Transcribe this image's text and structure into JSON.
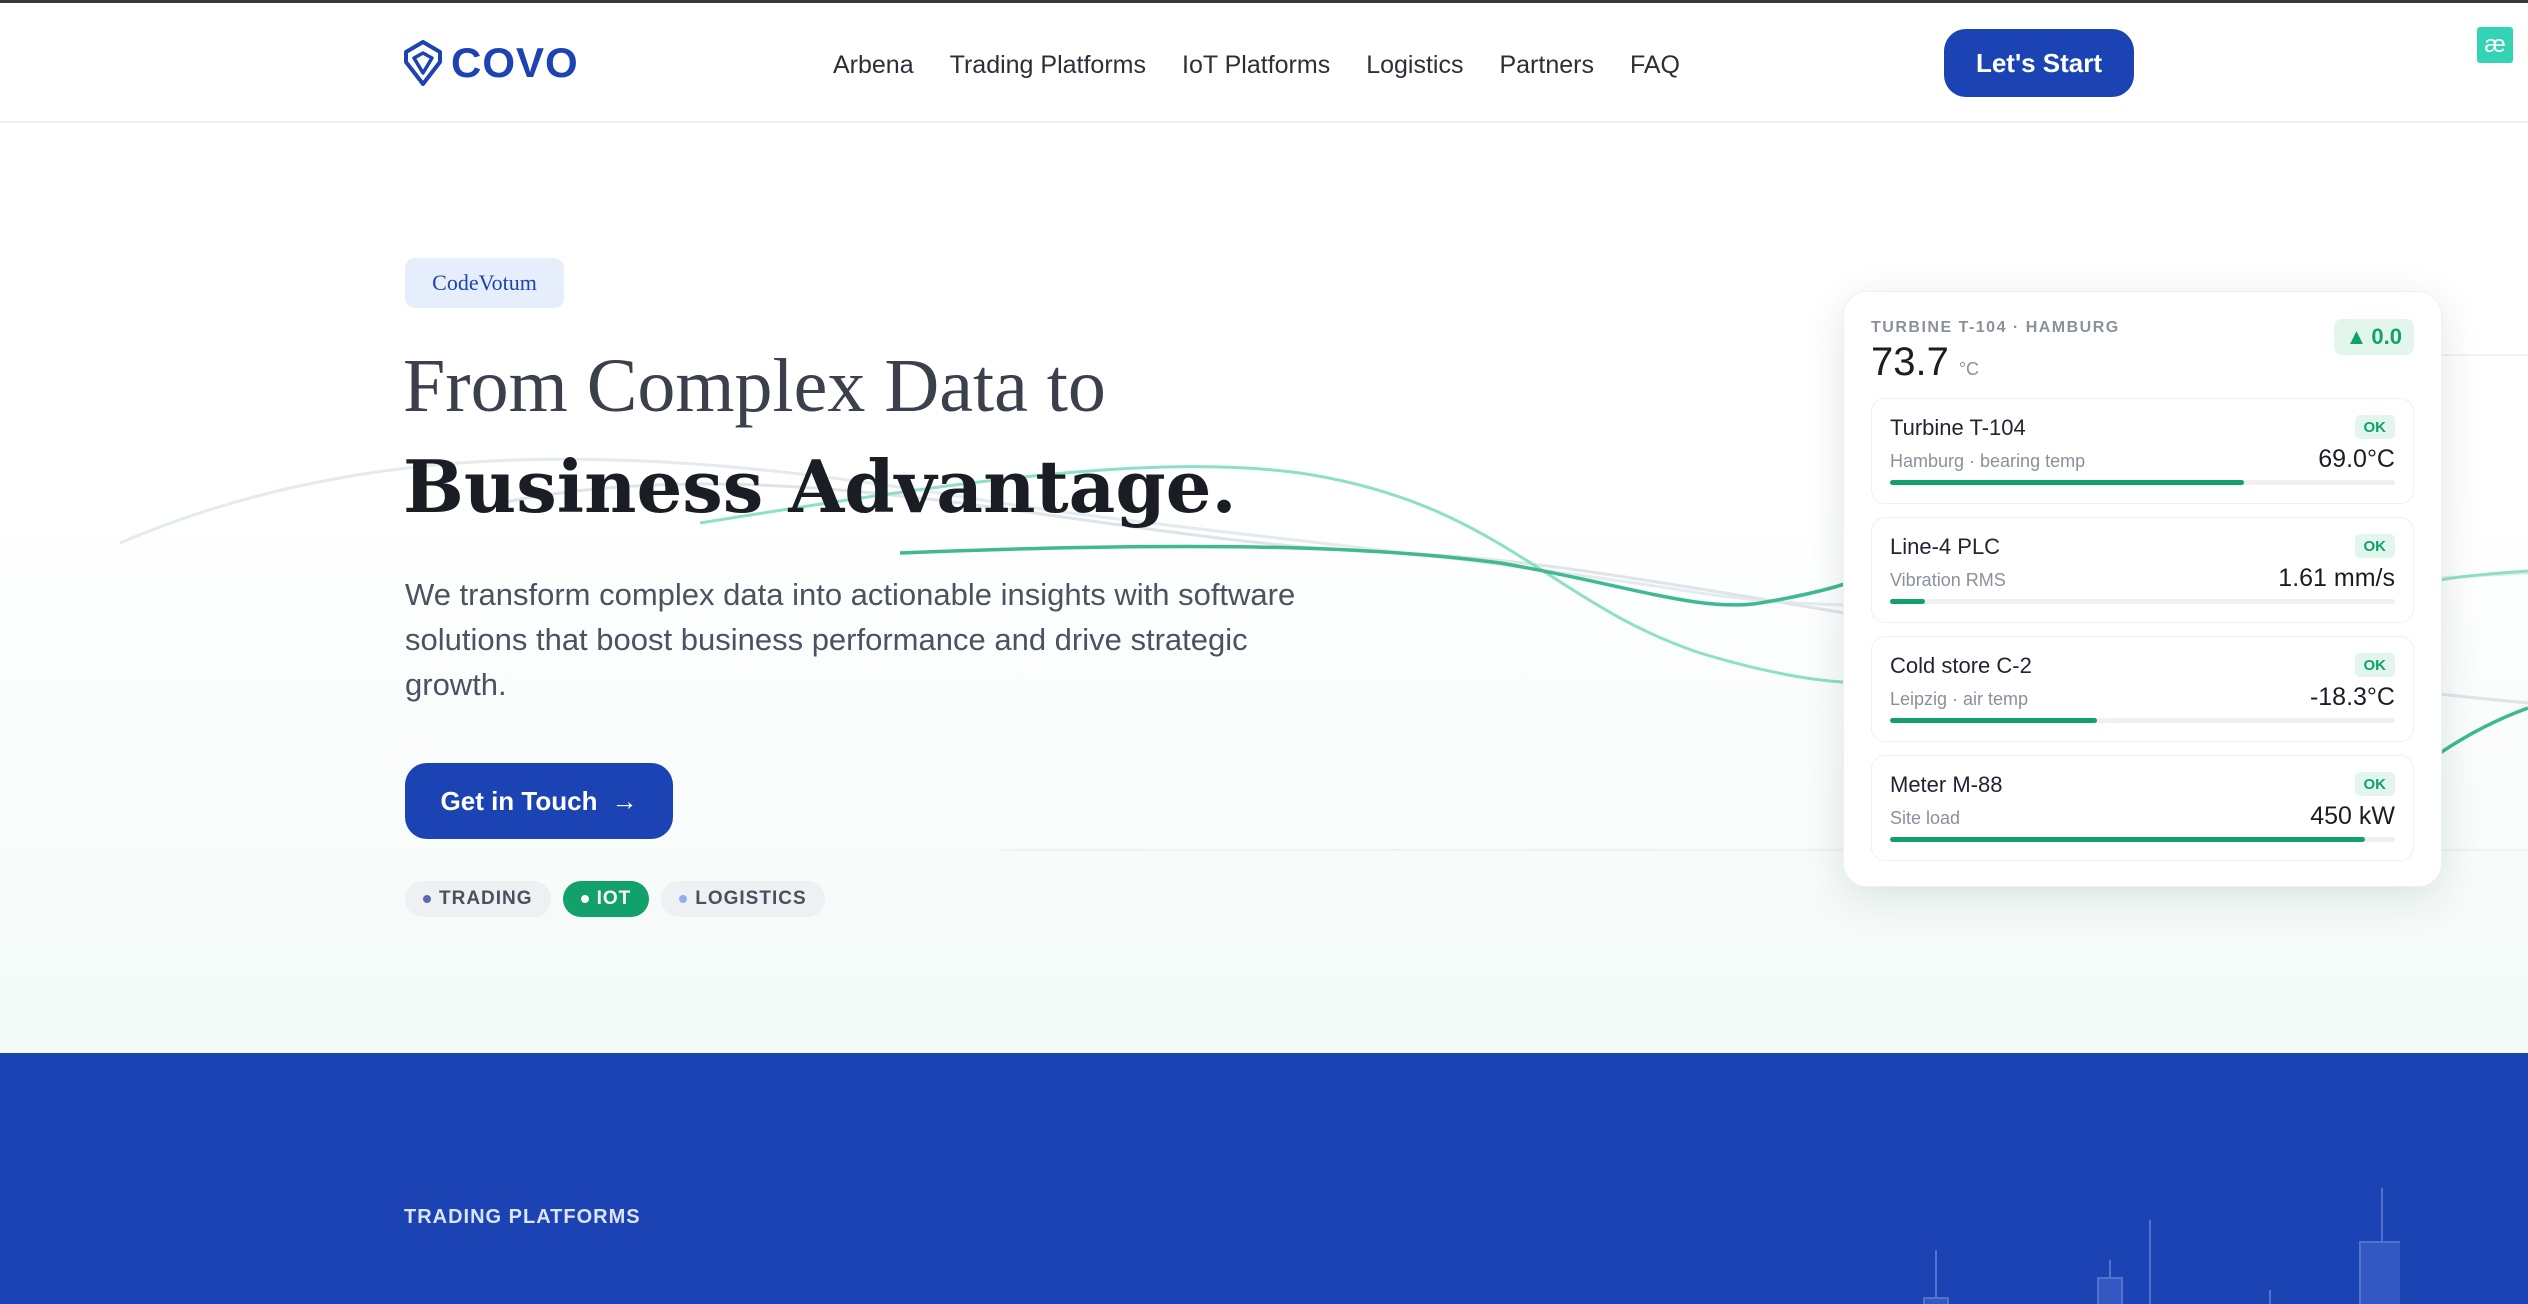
{
  "header": {
    "logo_text": "COVO",
    "nav": [
      {
        "label": "Arbena"
      },
      {
        "label": "Trading Platforms"
      },
      {
        "label": "IoT Platforms"
      },
      {
        "label": "Logistics"
      },
      {
        "label": "Partners"
      },
      {
        "label": "FAQ"
      }
    ],
    "cta_label": "Let's Start",
    "corner_badge": "æ"
  },
  "hero": {
    "chip": "CodeVotum",
    "title_line1": "From Complex Data to",
    "title_line2": "Business Advantage.",
    "description": "We transform complex data into actionable insights with software solutions that boost business performance and drive strategic growth.",
    "cta_label": "Get in Touch",
    "cta_icon": "arrow-right-icon",
    "tags": [
      {
        "label": "TRADING",
        "active": false
      },
      {
        "label": "IOT",
        "active": true
      },
      {
        "label": "LOGISTICS",
        "active": false
      }
    ]
  },
  "card": {
    "location": "TURBINE T-104 · HAMBURG",
    "temperature": "73.7",
    "unit": "°C",
    "delta": "0.0",
    "delta_icon": "triangle-up-icon",
    "rows": [
      {
        "name": "Turbine T-104",
        "sub": "Hamburg · bearing temp",
        "status": "OK",
        "value": "69.0°C",
        "fill": 0.7
      },
      {
        "name": "Line-4 PLC",
        "sub": "Vibration RMS",
        "status": "OK",
        "value": "1.61 mm/s",
        "fill": 0.07
      },
      {
        "name": "Cold store C-2",
        "sub": "Leipzig · air temp",
        "status": "OK",
        "value": "-18.3°C",
        "fill": 0.41
      },
      {
        "name": "Meter M-88",
        "sub": "Site load",
        "status": "OK",
        "value": "450 kW",
        "fill": 0.94
      }
    ]
  },
  "section": {
    "label": "TRADING PLATFORMS"
  },
  "colors": {
    "brand_blue": "#1c43b3",
    "accent_green": "#12a06b",
    "badge_teal": "#35d3b6"
  }
}
